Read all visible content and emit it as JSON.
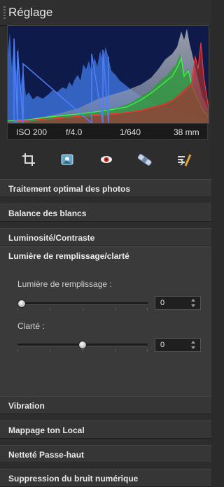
{
  "panel": {
    "title": "Réglage"
  },
  "histogram": {
    "channels": [
      "blue",
      "green",
      "red",
      "luminance"
    ]
  },
  "exif": {
    "iso": "ISO 200",
    "aperture": "f/4.0",
    "shutter": "1/640",
    "focal": "38 mm"
  },
  "toolbar": {
    "icons": [
      "crop-icon",
      "photo-enhance-icon",
      "red-eye-icon",
      "spot-heal-icon",
      "retouch-brush-icon"
    ]
  },
  "sections": {
    "optimal": "Traitement optimal des photos",
    "white_balance": "Balance des blancs",
    "brightness": "Luminosité/Contraste",
    "fill_light": "Lumière de remplissage/clarté",
    "vibrance": "Vibration",
    "local_tone": "Mappage ton Local",
    "highpass": "Netteté Passe-haut",
    "noise": "Suppression du bruit numérique"
  },
  "fill_light_panel": {
    "fill_label": "Lumière de remplissage :",
    "fill_value": "0",
    "fill_level": 0,
    "clarity_label": "Clarté :",
    "clarity_value": "0",
    "clarity_level": 0.5
  }
}
